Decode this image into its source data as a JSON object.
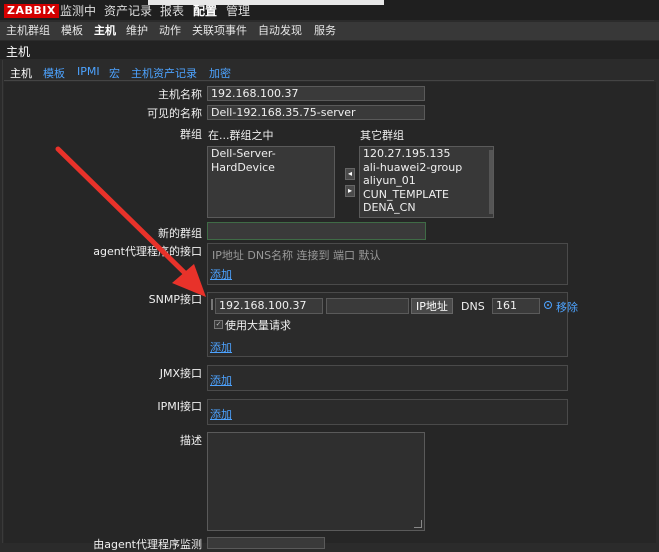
{
  "topbar": {
    "logo": "ZABBIX",
    "menu": [
      "监测中",
      "资产记录",
      "报表",
      "配置",
      "管理"
    ],
    "active_index": 3
  },
  "subbar": {
    "items": [
      "主机群组",
      "模板",
      "主机",
      "维护",
      "动作",
      "关联项事件",
      "自动发现",
      "服务"
    ],
    "active_index": 2
  },
  "page_title": "主机",
  "tabs": [
    "主机",
    "模板",
    "IPMI",
    "宏",
    "主机资产记录",
    "加密"
  ],
  "form": {
    "host_name_label": "主机名称",
    "host_name_value": "192.168.100.37",
    "visible_name_label": "可见的名称",
    "visible_name_value": "Dell-192.168.35.75-server",
    "groups_label": "群组",
    "in_groups_label": "在...群组之中",
    "other_groups_label": "其它群组",
    "in_groups": [
      "Dell-Server-HardDevice"
    ],
    "other_groups": [
      "120.27.195.135",
      "ali-huawei2-group",
      "aliyun_01",
      "CUN_TEMPLATE",
      "DENA_CN"
    ],
    "new_group_label": "新的群组",
    "agent_label": "agent代理程序的接口",
    "agent_headers": "IP地址 DNS名称 连接到 端口 默认",
    "add_link": "添加",
    "snmp_label": "SNMP接口",
    "snmp_ip": "192.168.100.37",
    "snmp_dns": "",
    "snmp_ip_btn": "IP地址",
    "snmp_dns_btn": "DNS",
    "snmp_port": "161",
    "remove_link": "移除",
    "bulk_label": "使用大量请求",
    "jmx_label": "JMX接口",
    "ipmi_label": "IPMI接口",
    "desc_label": "描述",
    "monitored_label": "由agent代理程序监测"
  },
  "colors": {
    "accent": "#4da3ff",
    "logo_bg": "#d40000",
    "arrow": "#e8322a"
  }
}
